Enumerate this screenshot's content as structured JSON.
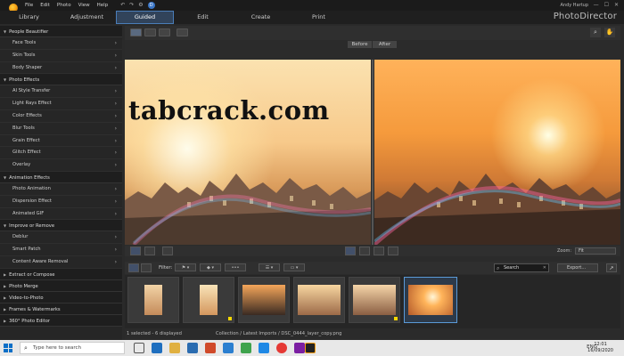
{
  "menu": [
    "File",
    "Edit",
    "Photo",
    "View",
    "Help"
  ],
  "user_name": "Andy Hartup",
  "brand": "PhotoDirector",
  "tabs": [
    {
      "label": "Library",
      "active": false
    },
    {
      "label": "Adjustment",
      "active": false
    },
    {
      "label": "Guided",
      "active": true
    },
    {
      "label": "Edit",
      "active": false
    },
    {
      "label": "Create",
      "active": false
    },
    {
      "label": "Print",
      "active": false
    }
  ],
  "sidebar": {
    "sections": [
      {
        "title": "People Beautifier",
        "items": [
          "Face Tools",
          "Skin Tools",
          "Body Shaper"
        ]
      },
      {
        "title": "Photo Effects",
        "items": [
          "AI Style Transfer",
          "Light Rays Effect",
          "Color Effects",
          "Blur Tools",
          "Grain Effect",
          "Glitch Effect",
          "Overlay"
        ]
      },
      {
        "title": "Animation Effects",
        "items": [
          "Photo Animation",
          "Dispersion Effect",
          "Animated GIF"
        ]
      },
      {
        "title": "Improve or Remove",
        "items": [
          "Deblur",
          "Smart Patch",
          "Content Aware Removal"
        ]
      }
    ],
    "collapsed": [
      "Extract or Compose",
      "Photo Merge",
      "Video-to-Photo",
      "Frames & Watermarks",
      "360° Photo Editor"
    ]
  },
  "compare": {
    "before": "Before",
    "after": "After"
  },
  "watermark": "tabcrack.com",
  "viewer": {
    "zoom_label": "Zoom:",
    "zoom_value": "Fit"
  },
  "filmstrip": {
    "filter_label": "Filter:",
    "search_placeholder": "Search",
    "export_label": "Export...",
    "selected_index": 5
  },
  "status": {
    "left": "1 selected - 6 displayed",
    "center": "Collection / Latest Imports / DSC_0444_layer_copy.png"
  },
  "taskbar": {
    "search_placeholder": "Type here to search",
    "lang": "ENG",
    "time": "12:01",
    "date": "16/09/2020"
  }
}
